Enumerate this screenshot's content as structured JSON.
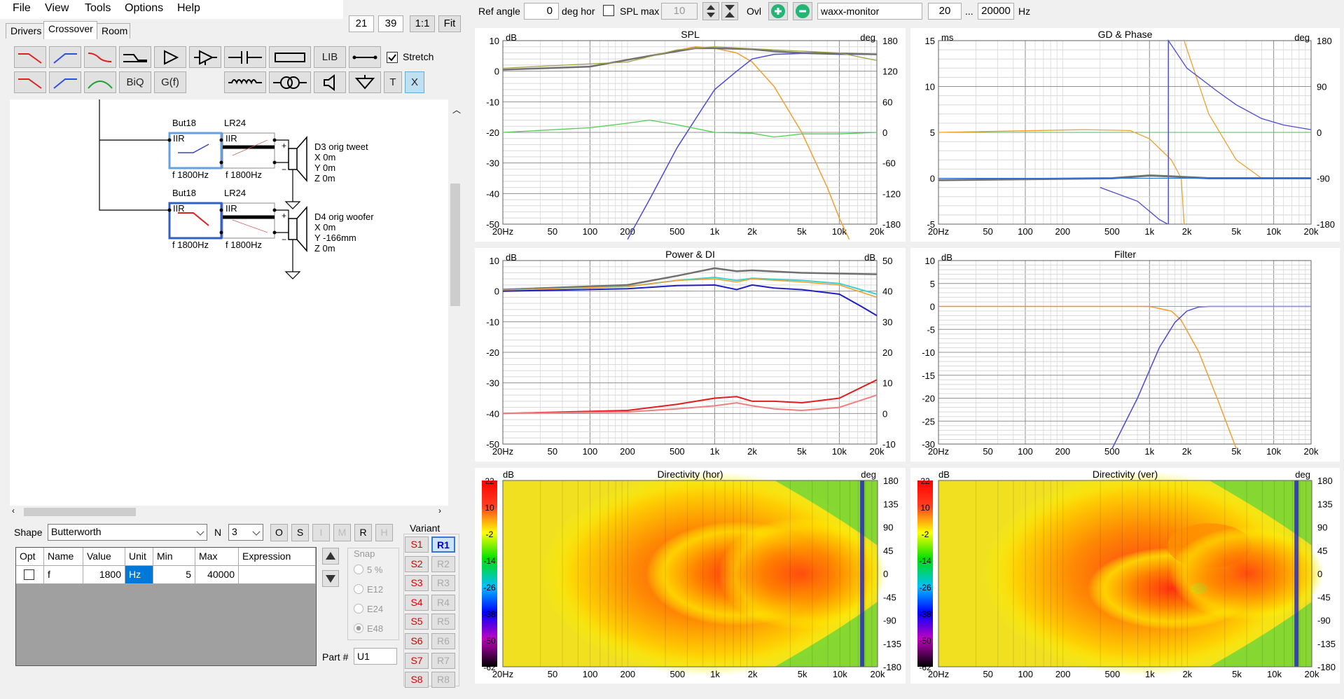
{
  "menu": [
    "File",
    "View",
    "Tools",
    "Options",
    "Help"
  ],
  "top_left": {
    "box1": "21",
    "box2": "39",
    "btn_1to1": "1:1",
    "btn_fit": "Fit"
  },
  "tabs": [
    {
      "label": "Drivers"
    },
    {
      "label": "Crossover"
    },
    {
      "label": "Room"
    }
  ],
  "toolbar": {
    "lib": "LIB",
    "biq": "BiQ",
    "gf": "G(f)",
    "stretch": "Stretch",
    "t": "T",
    "x": "X"
  },
  "top": {
    "ref_angle_label": "Ref angle",
    "ref_angle_value": "0",
    "deg_hor": "deg hor",
    "spl_max_label": "SPL max",
    "spl_max_value": "10",
    "ovl": "Ovl",
    "preset": "waxx-monitor",
    "f_from": "20",
    "dots": "...",
    "f_to": "20000",
    "hz": "Hz"
  },
  "schematic": {
    "tweeter": {
      "filter1_name": "But18",
      "filter1_type": "IIR",
      "filter1_freq": "f   1800Hz",
      "filter2_name": "LR24",
      "filter2_type": "IIR",
      "filter2_freq": "f   1800Hz",
      "label": "D3 orig tweet",
      "x": "X 0m",
      "y": "Y 0m",
      "z": "Z 0m"
    },
    "woofer": {
      "filter1_name": "But18",
      "filter1_type": "IIR",
      "filter1_freq": "f   1800Hz",
      "filter2_name": "LR24",
      "filter2_type": "IIR",
      "filter2_freq": "f   1800Hz",
      "label": "D4 orig woofer",
      "x": "X 0m",
      "y": "Y -166mm",
      "z": "Z 0m"
    }
  },
  "shape": {
    "label": "Shape",
    "value": "Butterworth",
    "n_label": "N",
    "n_value": "3",
    "buttons": [
      "O",
      "S",
      "I",
      "M",
      "R",
      "H"
    ]
  },
  "grid": {
    "headers": [
      "Opt",
      "Name",
      "Value",
      "Unit",
      "Min",
      "Max",
      "Expression"
    ],
    "row": {
      "name": "f",
      "value": "1800",
      "unit": "Hz",
      "min": "5",
      "max": "40000",
      "expression": ""
    }
  },
  "snap": {
    "label": "Snap",
    "options": [
      "5 %",
      "E12",
      "E24",
      "E48"
    ],
    "selected": "E48"
  },
  "part": {
    "label": "Part #",
    "value": "U1"
  },
  "variant": {
    "label": "Variant",
    "s": [
      "S1",
      "S2",
      "S3",
      "S4",
      "S5",
      "S6",
      "S7",
      "S8"
    ],
    "r": [
      "R1",
      "R2",
      "R3",
      "R4",
      "R5",
      "R6",
      "R7",
      "R8"
    ],
    "selected": "R1"
  },
  "freq_ticks": [
    "20Hz",
    "50",
    "100",
    "200",
    "500",
    "1k",
    "2k",
    "5k",
    "10k",
    "20k"
  ],
  "panels": {
    "spl": {
      "title": "SPL",
      "left_unit": "dB",
      "right_unit": "deg",
      "left_ticks": [
        "10",
        "0",
        "-10",
        "-20",
        "-30",
        "-40",
        "-50"
      ],
      "right_ticks": [
        "180",
        "120",
        "60",
        "0",
        "-60",
        "-120",
        "-180"
      ]
    },
    "gd": {
      "title": "GD & Phase",
      "left_unit": "ms",
      "right_unit": "deg",
      "left_ticks": [
        "15",
        "10",
        "5",
        "0",
        "-5"
      ],
      "right_ticks": [
        "180",
        "90",
        "0",
        "-90",
        "-180"
      ]
    },
    "power": {
      "title": "Power & DI",
      "left_unit": "dB",
      "right_unit": "dB",
      "left_ticks": [
        "10",
        "0",
        "-10",
        "-20",
        "-30",
        "-40",
        "-50"
      ],
      "right_ticks": [
        "50",
        "40",
        "30",
        "20",
        "10",
        "0",
        "-10"
      ]
    },
    "filter": {
      "title": "Filter",
      "left_unit": "dB",
      "left_ticks": [
        "10",
        "5",
        "0",
        "-5",
        "-10",
        "-15",
        "-20",
        "-25",
        "-30"
      ]
    },
    "dir_hor": {
      "title": "Directivity (hor)",
      "left_unit": "dB",
      "right_unit": "deg",
      "scale_ticks": [
        "22",
        "10",
        "-2",
        "-14",
        "-26",
        "-38",
        "-50",
        "-62"
      ],
      "right_ticks": [
        "180",
        "135",
        "90",
        "45",
        "0",
        "-45",
        "-90",
        "-135",
        "-180"
      ]
    },
    "dir_ver": {
      "title": "Directivity (ver)",
      "left_unit": "dB",
      "right_unit": "deg",
      "scale_ticks": [
        "22",
        "10",
        "-2",
        "-14",
        "-26",
        "-38",
        "-50",
        "-62"
      ],
      "right_ticks": [
        "180",
        "135",
        "90",
        "45",
        "0",
        "-45",
        "-90",
        "-135",
        "-180"
      ]
    }
  },
  "colors": {
    "blue": "#4a4ad8",
    "orange": "#f0a030",
    "green": "#50d050",
    "gray": "#707070",
    "red": "#e02020"
  }
}
